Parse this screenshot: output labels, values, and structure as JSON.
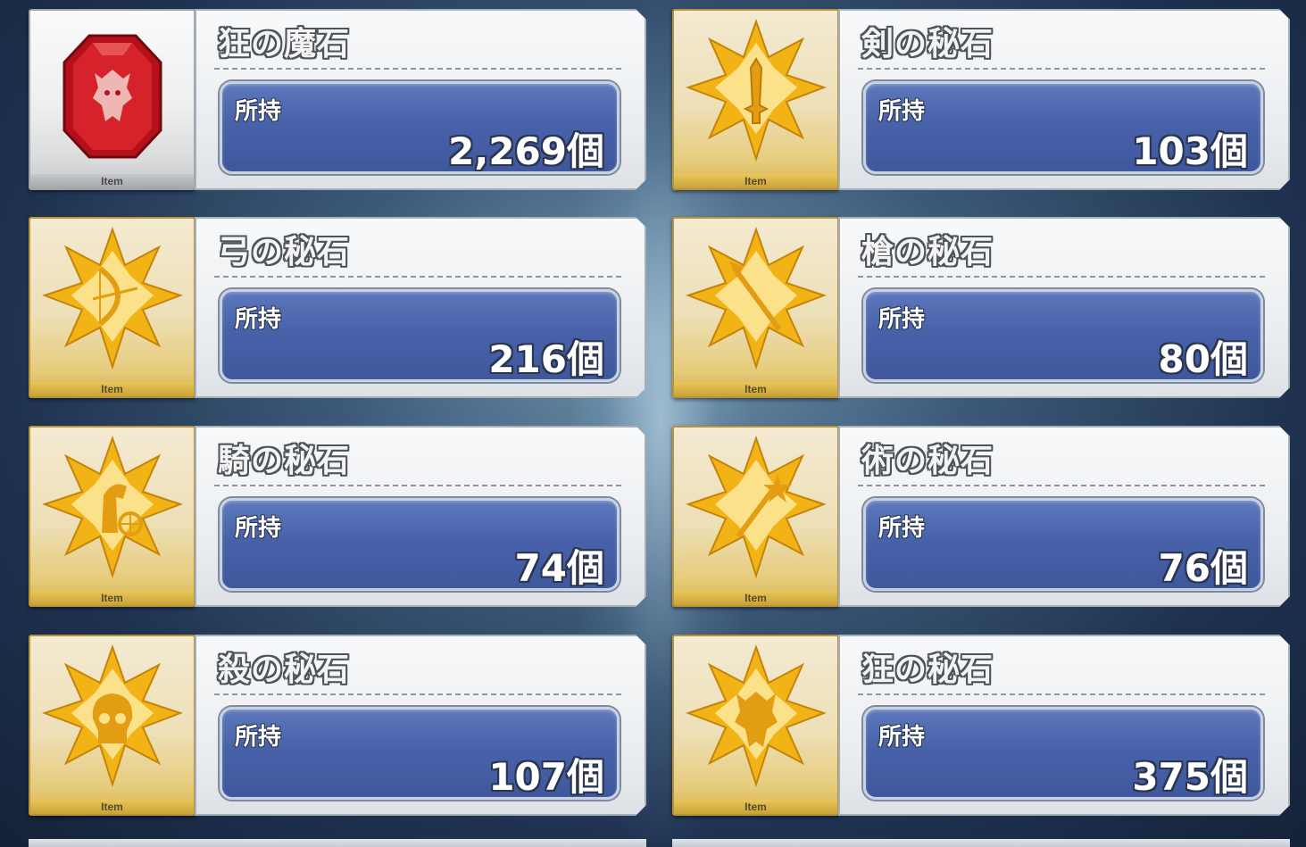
{
  "colors": {
    "count_box": "#4a64ab",
    "gold_frame": "#b99338",
    "silver_frame": "#9ea3a8",
    "gem_red": "#c8141c",
    "gold_star": "#f2b316"
  },
  "items": [
    {
      "name": "狂の魔石",
      "owned_label": "所持",
      "count": "2,269個",
      "tag": "Item",
      "icon": "red-gem-berserker-icon",
      "frame": "silver"
    },
    {
      "name": "剣の秘石",
      "owned_label": "所持",
      "count": "103個",
      "tag": "Item",
      "icon": "gold-star-sword-icon",
      "frame": "gold"
    },
    {
      "name": "弓の秘石",
      "owned_label": "所持",
      "count": "216個",
      "tag": "Item",
      "icon": "gold-star-bow-icon",
      "frame": "gold"
    },
    {
      "name": "槍の秘石",
      "owned_label": "所持",
      "count": "80個",
      "tag": "Item",
      "icon": "gold-star-lance-icon",
      "frame": "gold"
    },
    {
      "name": "騎の秘石",
      "owned_label": "所持",
      "count": "74個",
      "tag": "Item",
      "icon": "gold-star-rider-icon",
      "frame": "gold"
    },
    {
      "name": "術の秘石",
      "owned_label": "所持",
      "count": "76個",
      "tag": "Item",
      "icon": "gold-star-caster-icon",
      "frame": "gold"
    },
    {
      "name": "殺の秘石",
      "owned_label": "所持",
      "count": "107個",
      "tag": "Item",
      "icon": "gold-star-assassin-icon",
      "frame": "gold"
    },
    {
      "name": "狂の秘石",
      "owned_label": "所持",
      "count": "375個",
      "tag": "Item",
      "icon": "gold-star-berserker-icon",
      "frame": "gold"
    }
  ]
}
